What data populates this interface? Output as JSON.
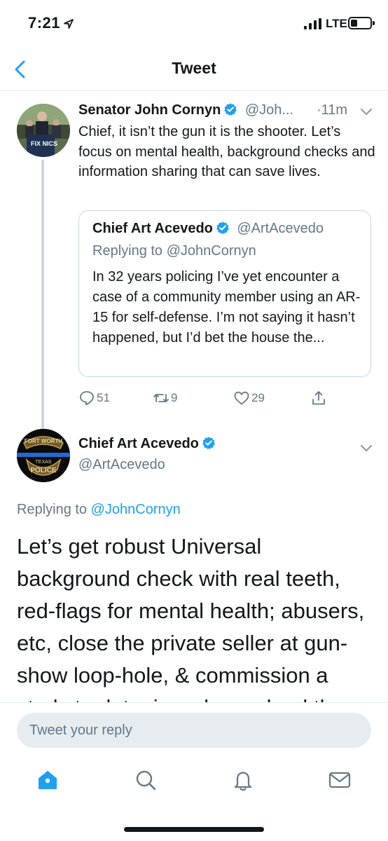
{
  "status_bar": {
    "time": "7:21",
    "network": "LTE"
  },
  "nav": {
    "title": "Tweet"
  },
  "main_tweet": {
    "name": "Senator John Cornyn",
    "handle": "@Joh...",
    "time": "·11m",
    "text": "Chief, it isn’t the gun it is the shooter. Let’s focus on mental health, background checks and information sharing that can save lives.",
    "avatar_sign": "FIX NICS",
    "quoted": {
      "name": "Chief Art Acevedo",
      "handle": "@ArtAcevedo",
      "replying_to": "Replying to @JohnCornyn",
      "text": "In 32 years policing I’ve yet encounter a case of a community member using an AR-15 for self-defense. I’m not saying it hasn’t happened, but I’d bet the house the..."
    },
    "actions": {
      "replies": "51",
      "retweets": "9",
      "likes": "29"
    }
  },
  "reply_tweet": {
    "name": "Chief Art Acevedo",
    "handle": "@ArtAcevedo",
    "avatar_badge": {
      "top": "FORT WORTH",
      "middle": "TEXAS",
      "bottom": "POLICE"
    },
    "replying_prefix": "Replying to ",
    "replying_handle": "@JohnCornyn",
    "text": "Let’s get robust Universal background check with real teeth, red-flags for mental health; abusers, etc, close the private seller at gun-show loop-hole, & commission a study to det mine why we lead the industrialized World"
  },
  "reply_bar": {
    "placeholder": "Tweet your reply"
  },
  "tab_bar": {
    "items": [
      "home-icon",
      "search-icon",
      "notifications-icon",
      "messages-icon"
    ]
  },
  "colors": {
    "accent": "#1da1f2",
    "secondary_text": "#657786",
    "divider": "#e1e8ed"
  }
}
